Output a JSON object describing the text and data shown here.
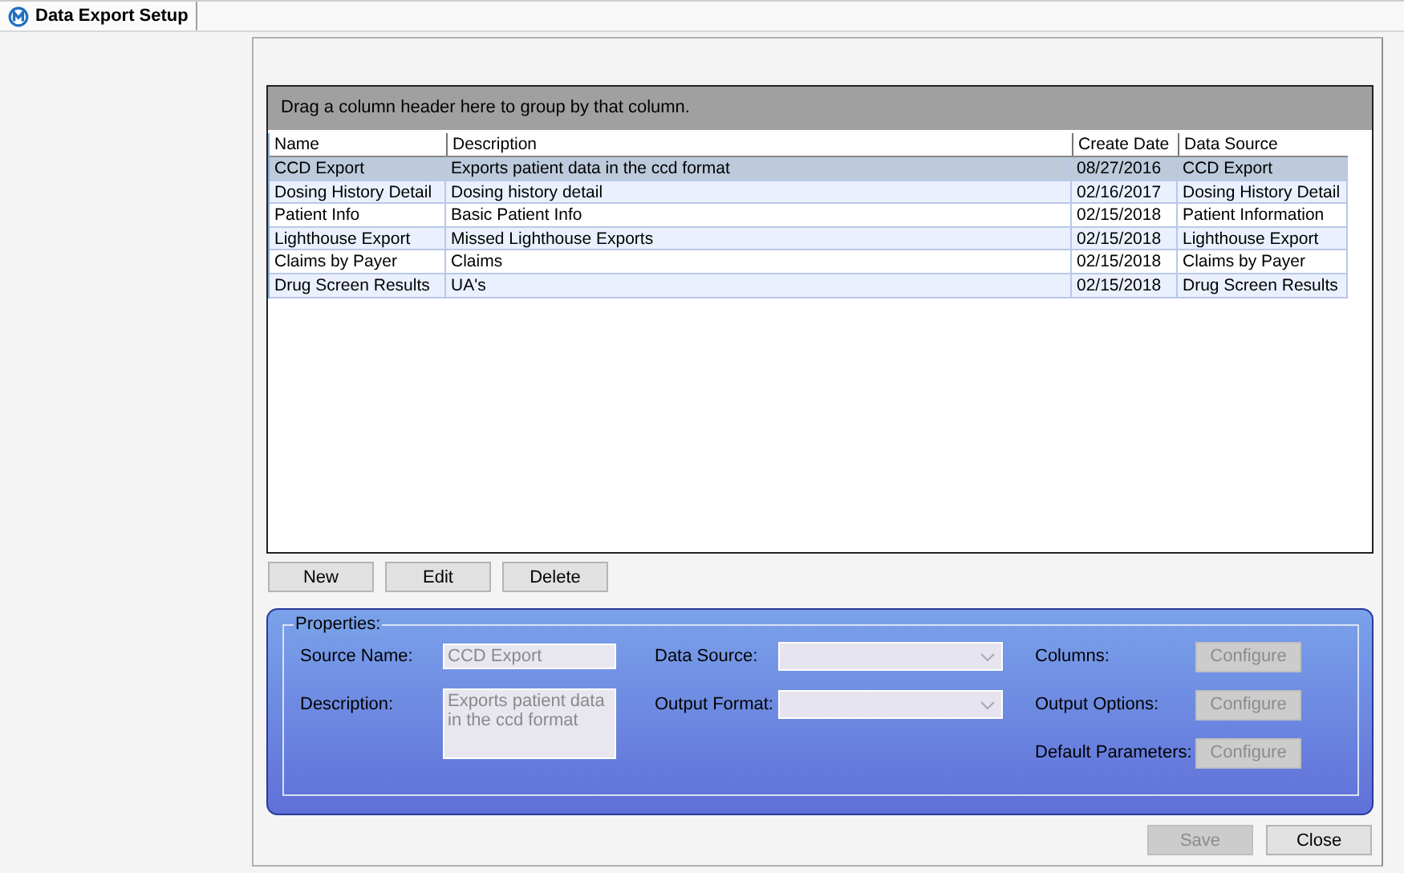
{
  "tab": {
    "title": "Data Export Setup",
    "selected": true
  },
  "grid": {
    "group_prompt": "Drag a column header here to group by that column.",
    "columns": [
      "Name",
      "Description",
      "Create Date",
      "Data Source"
    ],
    "rows": [
      {
        "cells": [
          "CCD Export",
          "Exports patient data in the ccd format",
          "08/27/2016",
          "CCD Export"
        ],
        "selected": true
      },
      {
        "cells": [
          "Dosing History Detail",
          "Dosing history detail",
          "02/16/2017",
          "Dosing History Detail"
        ],
        "selected": false
      },
      {
        "cells": [
          "Patient Info",
          "Basic Patient Info",
          "02/15/2018",
          "Patient Information"
        ],
        "selected": false
      },
      {
        "cells": [
          "Lighthouse Export",
          "Missed Lighthouse Exports",
          "02/15/2018",
          "Lighthouse Export"
        ],
        "selected": false
      },
      {
        "cells": [
          "Claims by Payer",
          "Claims",
          "02/15/2018",
          "Claims by Payer"
        ],
        "selected": false
      },
      {
        "cells": [
          "Drug Screen Results",
          "UA's",
          "02/15/2018",
          "Drug Screen Results"
        ],
        "selected": false
      }
    ]
  },
  "grid_buttons": [
    {
      "label": "New",
      "disabled": false
    },
    {
      "label": "Edit",
      "disabled": false
    },
    {
      "label": "Delete",
      "disabled": false
    }
  ],
  "properties": {
    "title": "Properties:",
    "source_name": {
      "label": "Source Name:",
      "value": "CCD Export",
      "disabled": true
    },
    "description": {
      "label": "Description:",
      "value": "Exports patient data in the ccd format",
      "disabled": true
    },
    "data_source": {
      "label": "Data Source:",
      "disabled": true
    },
    "output_format": {
      "label": "Output Format:",
      "disabled": true
    },
    "configs": [
      {
        "label": "Columns:",
        "button": "Configure",
        "disabled": true
      },
      {
        "label": "Output Options:",
        "button": "Configure",
        "disabled": true
      },
      {
        "label": "Default Parameters:",
        "button": "Configure",
        "disabled": true
      }
    ]
  },
  "footer_buttons": [
    {
      "label": "Save",
      "disabled": true
    },
    {
      "label": "Close",
      "disabled": false
    }
  ]
}
